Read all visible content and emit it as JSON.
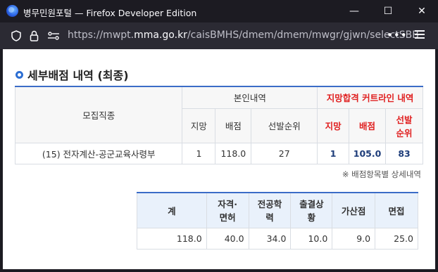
{
  "window": {
    "title": "병무민원포털 — Firefox Developer Edition",
    "minimize_label": "—",
    "maximize_label": "☐",
    "close_label": "✕"
  },
  "browser": {
    "url_prefix": "https://mwpt.",
    "url_domain": "mma.go.kr",
    "url_path": "/caisBMHS/dmem/dmem/mwgr/gjwn/selectSBB",
    "more_label": "•••"
  },
  "section": {
    "title": "세부배점 내역 (최종)"
  },
  "main_table": {
    "col_mojip": "모집직종",
    "group_self": "본인내역",
    "group_cutline": "지망합격 커트라인 내역",
    "headers": {
      "jimang": "지망",
      "baejeom": "배점",
      "rank": "선발순위",
      "cut_jimang": "지망",
      "cut_baejeom": "배점",
      "cut_rank_1": "선발",
      "cut_rank_2": "순위"
    },
    "row": {
      "mojip": "(15) 전자계산-공군교육사령부",
      "jimang": "1",
      "baejeom": "118.0",
      "rank": "27",
      "cut_jimang": "1",
      "cut_baejeom": "105.0",
      "cut_rank": "83"
    }
  },
  "note": "※ 배점항목별 상세내역",
  "detail_table": {
    "headers": [
      [
        "계"
      ],
      [
        "자격·",
        "면허"
      ],
      [
        "전공학",
        "력"
      ],
      [
        "출결상",
        "황"
      ],
      [
        "가산점"
      ],
      [
        "면접"
      ]
    ],
    "values": [
      "118.0",
      "40.0",
      "34.0",
      "10.0",
      "9.0",
      "25.0"
    ]
  },
  "colors": {
    "accent_blue": "#2d6fd3",
    "cutline_red": "#e02020",
    "cutline_value_navy": "#1e3d7a"
  }
}
